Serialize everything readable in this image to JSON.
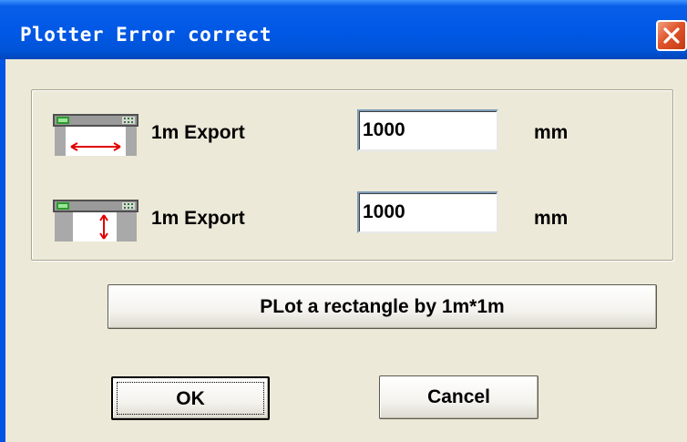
{
  "window": {
    "title": "Plotter Error correct",
    "close_icon": "close-x-icon"
  },
  "rows": [
    {
      "icon": "plotter-horizontal-measure-icon",
      "label": "1m Export",
      "value": "1000",
      "unit": "mm"
    },
    {
      "icon": "plotter-vertical-measure-icon",
      "label": "1m Export",
      "value": "1000",
      "unit": "mm"
    }
  ],
  "buttons": {
    "plot_label": "PLot a rectangle by 1m*1m",
    "ok_label": "OK",
    "cancel_label": "Cancel"
  },
  "colors": {
    "titlebar": "#0058e6",
    "dialog_face": "#ece9d8",
    "close_button": "#e0552c",
    "measure_arrow": "#e00000"
  }
}
